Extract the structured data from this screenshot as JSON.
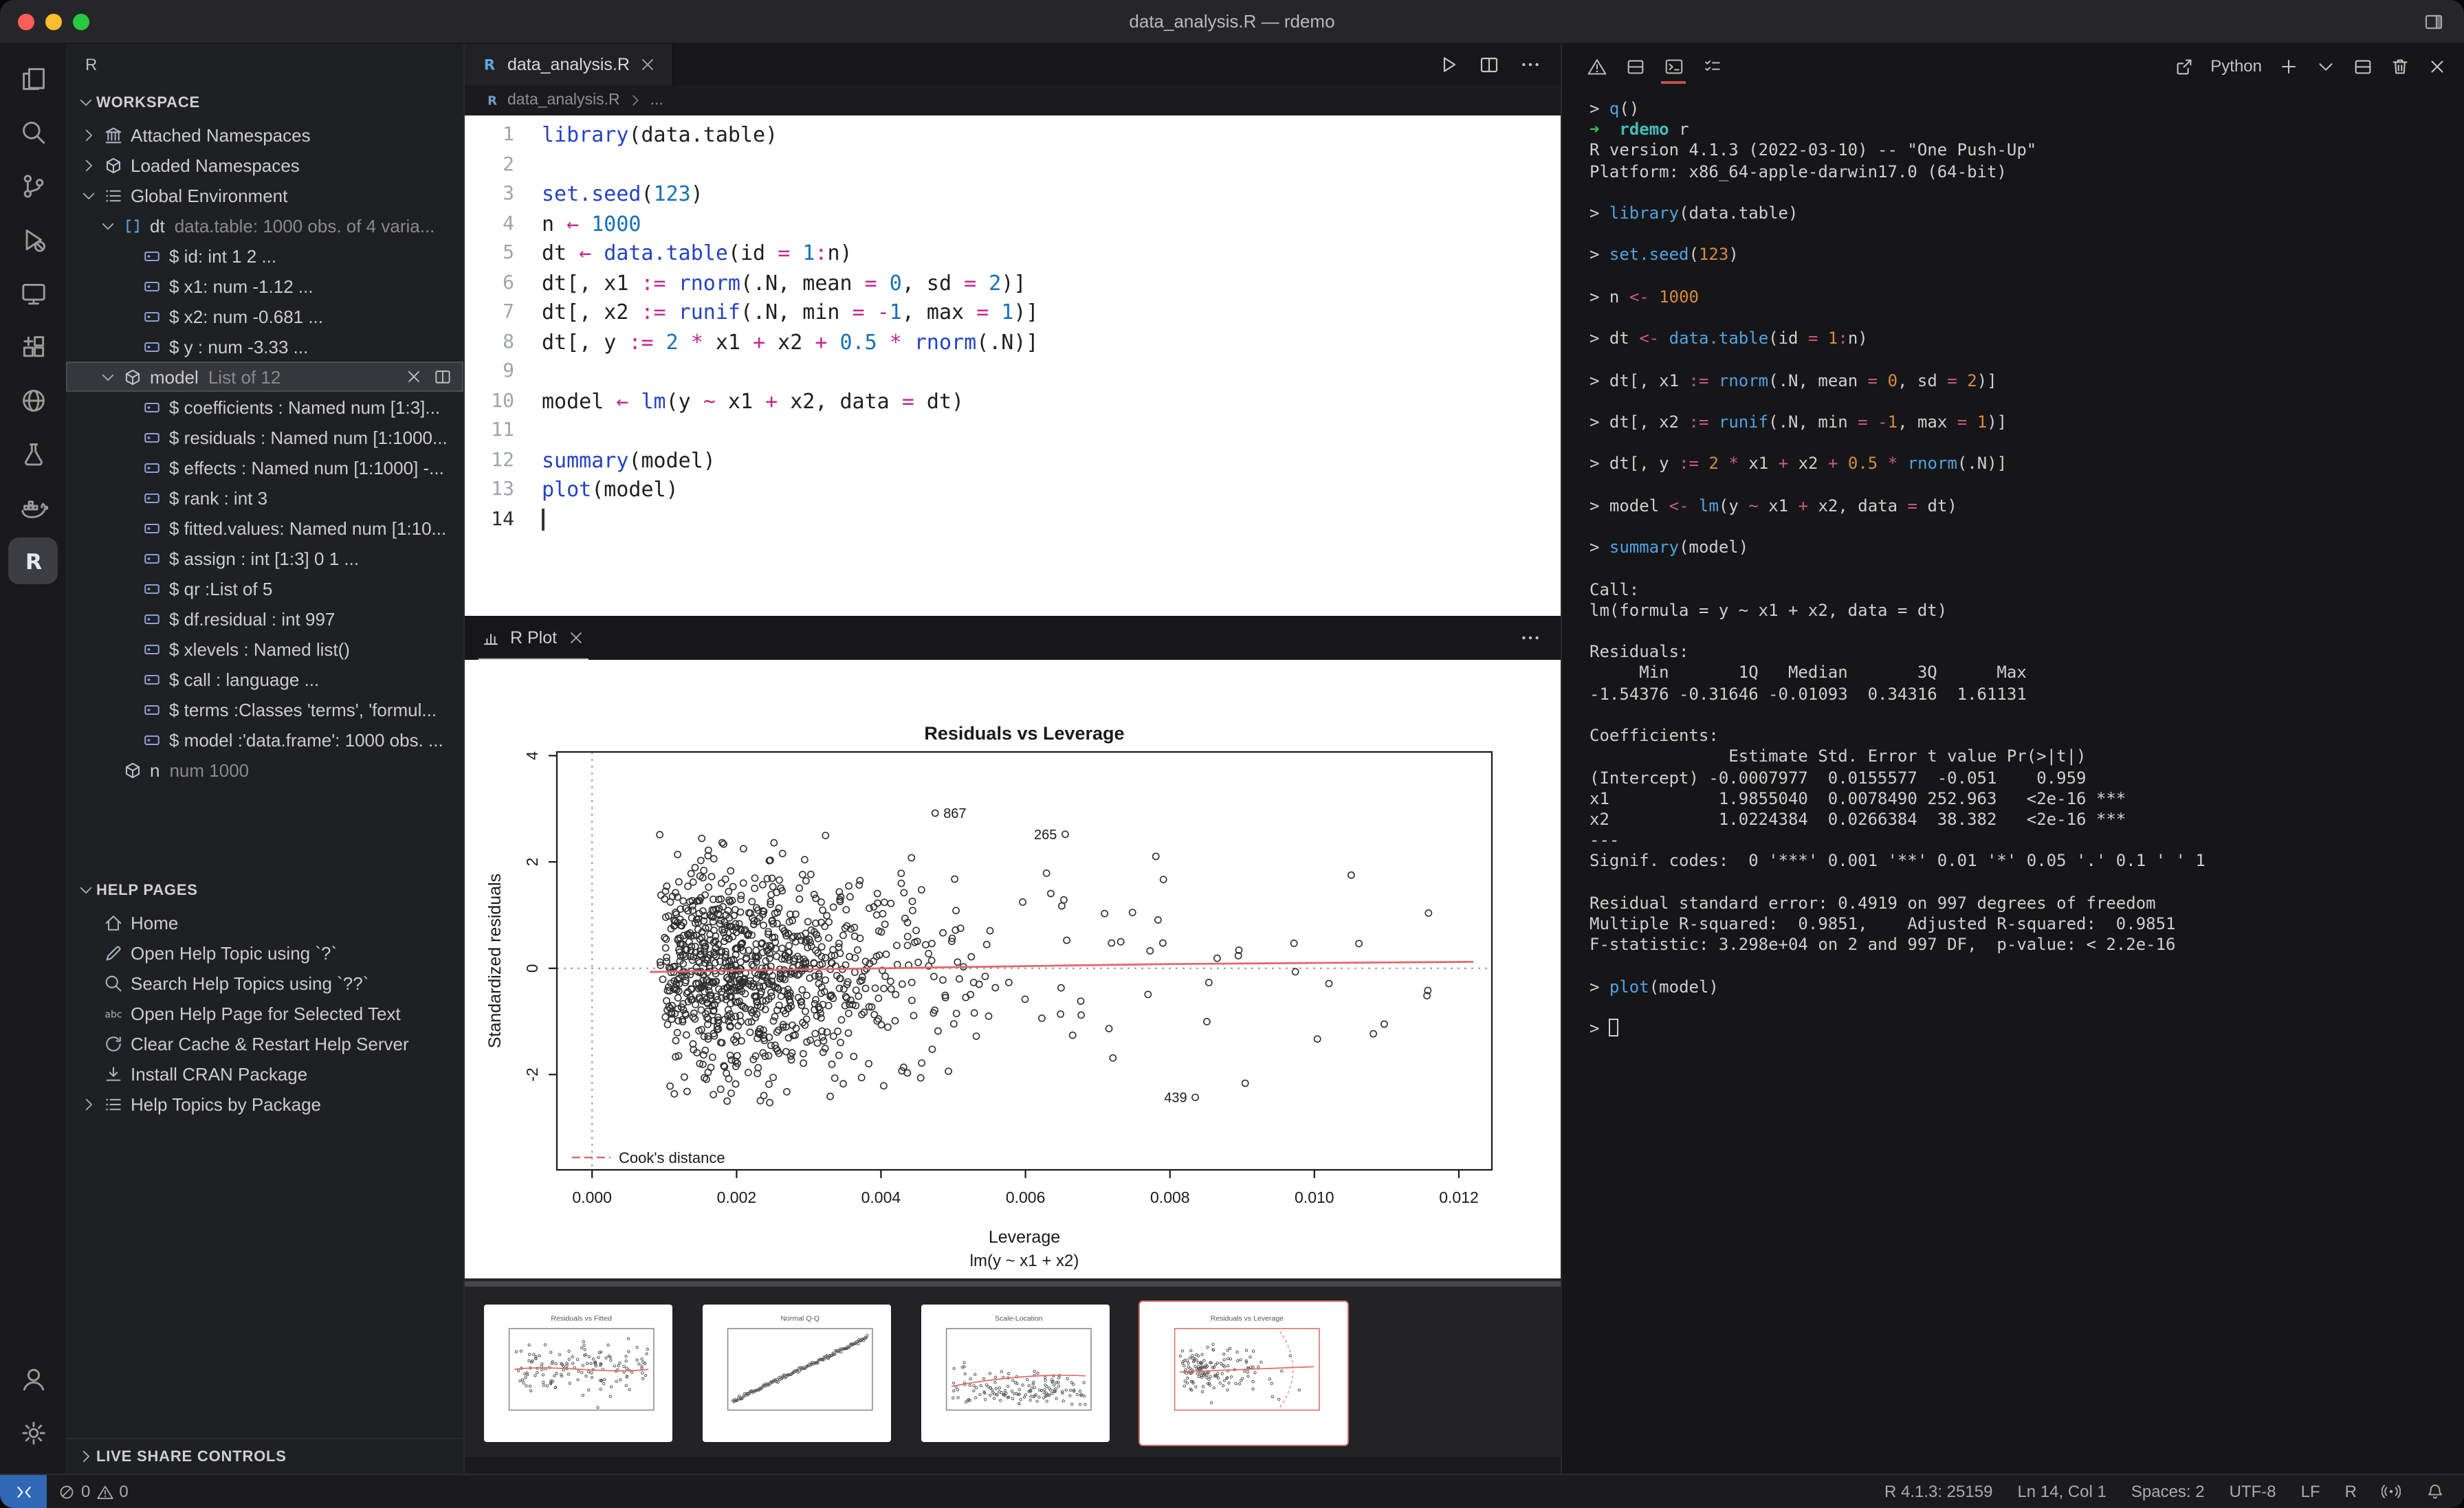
{
  "window": {
    "title": "data_analysis.R — rdemo",
    "traffic_lights": [
      "#ff5f57",
      "#febc2e",
      "#28c840"
    ]
  },
  "colors": {
    "remote_blue": "#3068b5",
    "plot_red": "#e06a6a",
    "terminal_active_underline": "#c4504a"
  },
  "activity_bar": {
    "items": [
      {
        "name": "explorer",
        "icon": "explorer"
      },
      {
        "name": "search",
        "icon": "search"
      },
      {
        "name": "source-control",
        "icon": "source-control"
      },
      {
        "name": "run-debug",
        "icon": "debug"
      },
      {
        "name": "remote-explorer",
        "icon": "monitor"
      },
      {
        "name": "extensions",
        "icon": "extensions"
      },
      {
        "name": "live-share",
        "icon": "globe"
      },
      {
        "name": "testing",
        "icon": "beaker"
      },
      {
        "name": "docker",
        "icon": "docker"
      },
      {
        "name": "r-view",
        "icon": "r-logo",
        "active": true
      }
    ],
    "bottom": [
      {
        "name": "account",
        "icon": "account"
      },
      {
        "name": "settings",
        "icon": "gear"
      }
    ]
  },
  "sidebar": {
    "title": "R",
    "workspace": {
      "header": "WORKSPACE",
      "rows": [
        {
          "depth": 0,
          "chev": "right",
          "icon": "library",
          "label": "Attached Namespaces"
        },
        {
          "depth": 0,
          "chev": "right",
          "icon": "package",
          "label": "Loaded Namespaces"
        },
        {
          "depth": 0,
          "chev": "down",
          "icon": "list",
          "label": "Global Environment"
        },
        {
          "depth": 1,
          "chev": "down",
          "icon": "brackets",
          "label": "dt",
          "desc": "data.table: 1000 obs. of 4 varia..."
        },
        {
          "depth": 2,
          "icon": "field",
          "label": "$ id: int 1 2 ..."
        },
        {
          "depth": 2,
          "icon": "field",
          "label": "$ x1: num -1.12 ..."
        },
        {
          "depth": 2,
          "icon": "field",
          "label": "$ x2: num -0.681 ..."
        },
        {
          "depth": 2,
          "icon": "field",
          "label": "$ y : num -3.33 ..."
        },
        {
          "depth": 1,
          "chev": "down",
          "icon": "package",
          "label": "model",
          "desc": "List of 12",
          "selected": true,
          "actions": [
            "close",
            "open-split"
          ]
        },
        {
          "depth": 2,
          "icon": "field",
          "label": "$ coefficients : Named num [1:3]..."
        },
        {
          "depth": 2,
          "icon": "field",
          "label": "$ residuals : Named num [1:1000..."
        },
        {
          "depth": 2,
          "icon": "field",
          "label": "$ effects : Named num [1:1000] -..."
        },
        {
          "depth": 2,
          "icon": "field",
          "label": "$ rank : int 3"
        },
        {
          "depth": 2,
          "icon": "field",
          "label": "$ fitted.values: Named num [1:10..."
        },
        {
          "depth": 2,
          "icon": "field",
          "label": "$ assign : int [1:3] 0 1 ..."
        },
        {
          "depth": 2,
          "icon": "field",
          "label": "$ qr :List of 5"
        },
        {
          "depth": 2,
          "icon": "field",
          "label": "$ df.residual : int 997"
        },
        {
          "depth": 2,
          "icon": "field",
          "label": "$ xlevels : Named list()"
        },
        {
          "depth": 2,
          "icon": "field",
          "label": "$ call : language ..."
        },
        {
          "depth": 2,
          "icon": "field",
          "label": "$ terms :Classes 'terms', 'formul..."
        },
        {
          "depth": 2,
          "icon": "field",
          "label": "$ model :'data.frame': 1000 obs. ..."
        },
        {
          "depth": 1,
          "icon": "package",
          "label": "n",
          "desc": "num 1000"
        }
      ]
    },
    "help": {
      "header": "HELP PAGES",
      "rows": [
        {
          "icon": "home",
          "label": "Home"
        },
        {
          "icon": "pencil",
          "label": "Open Help Topic using `?`"
        },
        {
          "icon": "magnify",
          "label": "Search Help Topics using `??`"
        },
        {
          "icon": "abc",
          "label": "Open Help Page for Selected Text"
        },
        {
          "icon": "refresh",
          "label": "Clear Cache & Restart Help Server"
        },
        {
          "icon": "install",
          "label": "Install CRAN Package"
        },
        {
          "icon": "list",
          "label": "Help Topics by Package",
          "chev": "right"
        }
      ]
    },
    "live_share": {
      "header": "LIVE SHARE CONTROLS"
    }
  },
  "editor": {
    "tab": {
      "label": "data_analysis.R"
    },
    "breadcrumb": {
      "file": "data_analysis.R",
      "more": "..."
    },
    "active_line": 14,
    "code_lines": [
      "library(data.table)",
      "",
      "set.seed(123)",
      "n ← 1000",
      "dt ← data.table(id = 1:n)",
      "dt[, x1 := rnorm(.N, mean = 0, sd = 2)]",
      "dt[, x2 := runif(.N, min = -1, max = 1)]",
      "dt[, y := 2 * x1 + x2 + 0.5 * rnorm(.N)]",
      "",
      "model ← lm(y ~ x1 + x2, data = dt)",
      "",
      "summary(model)",
      "plot(model)",
      ""
    ]
  },
  "plot_panel": {
    "tab": "R Plot"
  },
  "chart_data": [
    {
      "type": "scatter",
      "title": "Residuals vs Leverage",
      "xlabel": "Leverage",
      "xlabel_sub": "lm(y ~ x1 + x2)",
      "ylabel": "Standardized residuals",
      "xticks": [
        0,
        0.002,
        0.004,
        0.006,
        0.008,
        0.01,
        0.012
      ],
      "xtick_labels": [
        "0.000",
        "0.002",
        "0.004",
        "0.006",
        "0.008",
        "0.010",
        "0.012"
      ],
      "yticks": [
        -2,
        0,
        2,
        4
      ],
      "xlim": [
        -0.0005,
        0.0125
      ],
      "ylim": [
        -3.8,
        4.1
      ],
      "n_points": 1000,
      "marker": "open-circle",
      "ref_h_line": 0,
      "ref_v_line": 0,
      "labeled_points": [
        {
          "label": "867",
          "x": 0.00475,
          "y": 2.92,
          "label_side": "right"
        },
        {
          "label": "265",
          "x": 0.00655,
          "y": 2.52,
          "label_side": "left"
        },
        {
          "label": "439",
          "x": 0.00835,
          "y": -2.43,
          "label_side": "left"
        }
      ],
      "smooth_line": [
        [
          0.0008,
          -0.07
        ],
        [
          0.002,
          -0.04
        ],
        [
          0.003,
          -0.02
        ],
        [
          0.004,
          0.0
        ],
        [
          0.005,
          0.02
        ],
        [
          0.0065,
          0.05
        ],
        [
          0.008,
          0.08
        ],
        [
          0.01,
          0.1
        ],
        [
          0.0122,
          0.12
        ]
      ],
      "legend": {
        "label": "Cook's distance",
        "style": "dashed",
        "color": "#e06a6a",
        "position": "bottom-left"
      },
      "cloud": {
        "seed": 20,
        "lev_min": 0.0009,
        "lev_theta": 0.00078,
        "lev_max": 0.0122,
        "resid_sd": 0.98,
        "resid_clip": 2.6
      }
    },
    {
      "type": "scatter",
      "role": "thumbnail",
      "title": "Residuals vs Fitted"
    },
    {
      "type": "scatter",
      "role": "thumbnail",
      "title": "Normal Q-Q"
    },
    {
      "type": "scatter",
      "role": "thumbnail",
      "title": "Scale-Location"
    },
    {
      "type": "scatter",
      "role": "thumbnail",
      "title": "Residuals vs Leverage",
      "active": true
    }
  ],
  "terminal_header": {
    "left_icons": [
      "warning",
      "split-panel",
      "terminal",
      "checklist"
    ],
    "active_left_icon": 2,
    "selector_label": "Python",
    "right_icons": [
      "launch",
      "plus",
      "chevron-down",
      "split-panel",
      "trash",
      "close"
    ]
  },
  "terminal": {
    "lines": [
      {
        "k": "cmd",
        "t": "q()"
      },
      {
        "k": "shell",
        "t": "➜  rdemo r"
      },
      {
        "k": "out",
        "t": "R version 4.1.3 (2022-03-10) -- \"One Push-Up\""
      },
      {
        "k": "out",
        "t": "Platform: x86_64-apple-darwin17.0 (64-bit)"
      },
      {
        "k": "out",
        "t": ""
      },
      {
        "k": "cmd",
        "t": "library(data.table)"
      },
      {
        "k": "out",
        "t": ""
      },
      {
        "k": "cmd",
        "t": "set.seed(123)"
      },
      {
        "k": "out",
        "t": ""
      },
      {
        "k": "cmd",
        "t": "n <- 1000"
      },
      {
        "k": "out",
        "t": ""
      },
      {
        "k": "cmd",
        "t": "dt <- data.table(id = 1:n)"
      },
      {
        "k": "out",
        "t": ""
      },
      {
        "k": "cmd",
        "t": "dt[, x1 := rnorm(.N, mean = 0, sd = 2)]"
      },
      {
        "k": "out",
        "t": ""
      },
      {
        "k": "cmd",
        "t": "dt[, x2 := runif(.N, min = -1, max = 1)]"
      },
      {
        "k": "out",
        "t": ""
      },
      {
        "k": "cmd",
        "t": "dt[, y := 2 * x1 + x2 + 0.5 * rnorm(.N)]"
      },
      {
        "k": "out",
        "t": ""
      },
      {
        "k": "cmd",
        "t": "model <- lm(y ~ x1 + x2, data = dt)"
      },
      {
        "k": "out",
        "t": ""
      },
      {
        "k": "cmd",
        "t": "summary(model)"
      },
      {
        "k": "out",
        "t": ""
      },
      {
        "k": "out",
        "t": "Call:"
      },
      {
        "k": "out",
        "t": "lm(formula = y ~ x1 + x2, data = dt)"
      },
      {
        "k": "out",
        "t": ""
      },
      {
        "k": "out",
        "t": "Residuals:"
      },
      {
        "k": "out",
        "t": "     Min       1Q   Median       3Q      Max "
      },
      {
        "k": "out",
        "t": "-1.54376 -0.31646 -0.01093  0.34316  1.61131 "
      },
      {
        "k": "out",
        "t": ""
      },
      {
        "k": "out",
        "t": "Coefficients:"
      },
      {
        "k": "out",
        "t": "              Estimate Std. Error t value Pr(>|t|)    "
      },
      {
        "k": "out",
        "t": "(Intercept) -0.0007977  0.0155577  -0.051    0.959    "
      },
      {
        "k": "out",
        "t": "x1           1.9855040  0.0078490 252.963   <2e-16 ***"
      },
      {
        "k": "out",
        "t": "x2           1.0224384  0.0266384  38.382   <2e-16 ***"
      },
      {
        "k": "out",
        "t": "---"
      },
      {
        "k": "out",
        "t": "Signif. codes:  0 '***' 0.001 '**' 0.01 '*' 0.05 '.' 0.1 ' ' 1"
      },
      {
        "k": "out",
        "t": ""
      },
      {
        "k": "out",
        "t": "Residual standard error: 0.4919 on 997 degrees of freedom"
      },
      {
        "k": "out",
        "t": "Multiple R-squared:  0.9851,    Adjusted R-squared:  0.9851 "
      },
      {
        "k": "out",
        "t": "F-statistic: 3.298e+04 on 2 and 997 DF,  p-value: < 2.2e-16"
      },
      {
        "k": "out",
        "t": ""
      },
      {
        "k": "cmd",
        "t": "plot(model)"
      },
      {
        "k": "out",
        "t": ""
      },
      {
        "k": "cursor"
      }
    ]
  },
  "status_bar": {
    "errors": "0",
    "warnings": "0",
    "right_items": [
      "R 4.1.3: 25159",
      "Ln 14, Col 1",
      "Spaces: 2",
      "UTF-8",
      "LF",
      "R"
    ]
  }
}
